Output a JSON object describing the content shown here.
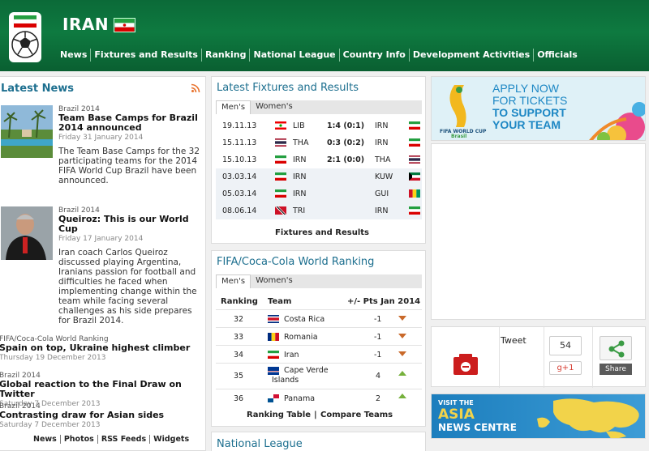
{
  "header": {
    "title": "IRAN",
    "nav": [
      "News",
      "Fixtures and Results",
      "Ranking",
      "National League",
      "Country Info",
      "Development Activities",
      "Officials"
    ]
  },
  "latest_news": {
    "title": "Latest News",
    "items": [
      {
        "category": "Brazil 2014",
        "headline_1": "Team Base Camps for Brazil",
        "headline_2": "2014 announced",
        "date": "Friday 31 January 2014",
        "excerpt": [
          "The Team Base Camps for the 32",
          "participating teams for the 2014",
          "FIFA World Cup Brazil have been",
          "announced."
        ]
      },
      {
        "category": "Brazil 2014",
        "headline_1": "Queiroz: This is our World Cup",
        "headline_2": "",
        "date": "Friday 17 January 2014",
        "excerpt": [
          "Iran coach Carlos Queiroz",
          "discussed playing Argentina,",
          "Iranians passion for football and",
          "difficulties he faced when",
          "implementing change within the",
          "team while facing several",
          "challenges as his side prepares",
          "for Brazil 2014."
        ]
      },
      {
        "category": "FIFA/Coca-Cola World Ranking",
        "headline_1": "Spain on top, Ukraine highest climber",
        "date": "Thursday 19 December 2013"
      },
      {
        "category": "Brazil 2014",
        "headline_1": "Global reaction to the Final Draw on Twitter",
        "date": "Saturday 7 December 2013"
      },
      {
        "category": "Brazil 2014",
        "headline_1": "Contrasting draw for Asian sides",
        "date": "Saturday 7 December 2013"
      }
    ],
    "footer_links": [
      "News",
      "Photos",
      "RSS Feeds",
      "Widgets"
    ]
  },
  "fixtures": {
    "title": "Latest Fixtures and Results",
    "tabs": [
      "Men's",
      "Women's"
    ],
    "rows": [
      {
        "date": "19.11.13",
        "home": "LIB",
        "score": "1:4 (0:1)",
        "away": "IRN"
      },
      {
        "date": "15.11.13",
        "home": "THA",
        "score": "0:3 (0:2)",
        "away": "IRN"
      },
      {
        "date": "15.10.13",
        "home": "IRN",
        "score": "2:1 (0:0)",
        "away": "THA"
      },
      {
        "date": "03.03.14",
        "home": "IRN",
        "score": "",
        "away": "KUW"
      },
      {
        "date": "05.03.14",
        "home": "IRN",
        "score": "",
        "away": "GUI"
      },
      {
        "date": "08.06.14",
        "home": "TRI",
        "score": "",
        "away": "IRN"
      }
    ],
    "link": "Fixtures and Results"
  },
  "ranking": {
    "title": "FIFA/Coca-Cola World Ranking",
    "tabs": [
      "Men's",
      "Women's"
    ],
    "headers": {
      "rank": "Ranking",
      "team": "Team",
      "change": "+/- Pts Jan 2014"
    },
    "rows": [
      {
        "rank": "32",
        "team": "Costa Rica",
        "team_2": "",
        "change": "-1",
        "trend": "down"
      },
      {
        "rank": "33",
        "team": "Romania",
        "team_2": "",
        "change": "-1",
        "trend": "down"
      },
      {
        "rank": "34",
        "team": "Iran",
        "team_2": "",
        "change": "-1",
        "trend": "down"
      },
      {
        "rank": "35",
        "team": "Cape Verde",
        "team_2": "Islands",
        "change": "4",
        "trend": "up"
      },
      {
        "rank": "36",
        "team": "Panama",
        "team_2": "",
        "change": "2",
        "trend": "up"
      }
    ],
    "links": [
      "Ranking Table",
      "Compare Teams"
    ]
  },
  "national_league": {
    "title": "National League"
  },
  "tickets_banner": {
    "lines": [
      "APPLY NOW",
      "FOR TICKETS",
      "TO SUPPORT",
      "YOUR TEAM"
    ],
    "logo_text_1": "FIFA WORLD CUP",
    "logo_text_2": "Brasil"
  },
  "social": {
    "tweet": "Tweet",
    "gplus_count": "54",
    "gplus": "g+1",
    "share": "Share"
  },
  "asia_banner": {
    "line_1": "VISIT THE",
    "line_2": "ASIA",
    "line_3": "NEWS CENTRE"
  },
  "colors": {
    "header_green": "#0e7a40",
    "title_blue": "#1d6f8f",
    "down_arrow": "#c9692a",
    "up_arrow": "#76b13c"
  }
}
